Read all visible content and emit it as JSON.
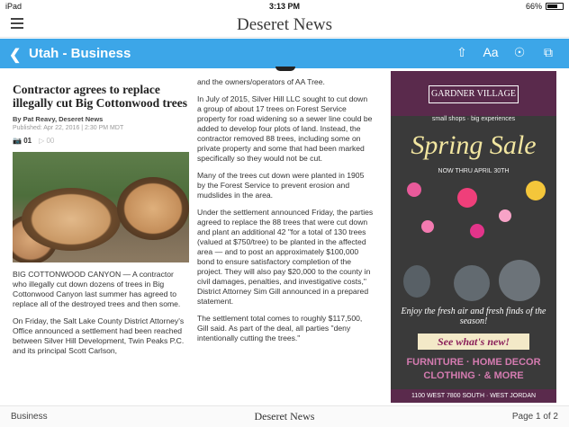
{
  "status_bar": {
    "device": "iPad",
    "time": "3:13 PM",
    "battery": "66%"
  },
  "header": {
    "brand": "Deseret News"
  },
  "section_bar": {
    "title": "Utah - Business"
  },
  "article": {
    "headline": "Contractor agrees to replace illegally cut Big Cottonwood trees",
    "byline": "By Pat Reavy, Deseret News",
    "published": "Published: Apr 22, 2016 | 2:30 PM MDT",
    "photo_count": "01",
    "video_count": "00",
    "col1_paragraphs": [
      "BIG COTTONWOOD CANYON — A contractor who illegally cut down dozens of trees in Big Cottonwood Canyon last summer has agreed to replace all of the destroyed trees and then some.",
      "On Friday, the Salt Lake County District Attorney's Office announced a settlement had been reached between Silver Hill Development, Twin Peaks P.C. and its principal Scott Carlson,"
    ],
    "col2_paragraphs": [
      "and the owners/operators of AA Tree.",
      "In July of 2015, Silver Hill LLC sought to cut down a group of about 17 trees on Forest Service property for road widening so a sewer line could be added to develop four plots of land. Instead, the contractor removed 88 trees, including some on private property and some that had been marked specifically so they would not be cut.",
      "Many of the trees cut down were planted in 1905 by the Forest Service to prevent erosion and mudslides in the area.",
      "Under the settlement announced Friday, the parties agreed to replace the 88 trees that were cut down and plant an additional 42 \"for a total of 130 trees (valued at $750/tree) to be planted in the affected area — and to post an approximately $100,000 bond to ensure satisfactory completion of the project. They will also pay $20,000 to the county in civil damages, penalties, and investigative costs,\" District Attorney Sim Gill announced in a prepared statement.",
      "The settlement total comes to roughly $117,500, Gill said. As part of the deal, all parties \"deny intentionally cutting the trees.\""
    ]
  },
  "ad": {
    "logo": "GARDNER VILLAGE",
    "tagline": "small shops · big experiences",
    "sale": "Spring Sale",
    "dates": "NOW THRU APRIL 30TH",
    "enjoy": "Enjoy the fresh air and fresh finds of the season!",
    "cta": "See what's new!",
    "line1": "FURNITURE · HOME DECOR",
    "line2": "CLOTHING · & MORE",
    "address": "1100 WEST 7800 SOUTH · WEST JORDAN"
  },
  "footer": {
    "section": "Business",
    "brand": "Deseret News",
    "page": "Page 1 of 2"
  },
  "colors": {
    "section_bar": "#3ca6e8",
    "ad_top": "#5a2a4c"
  }
}
